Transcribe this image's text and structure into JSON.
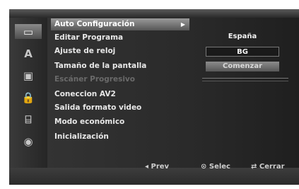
{
  "sidebar": {
    "icons": [
      {
        "name": "disc-settings-icon",
        "glyph": "▭"
      },
      {
        "name": "language-icon",
        "glyph": "A"
      },
      {
        "name": "audio-icon",
        "glyph": "▣"
      },
      {
        "name": "lock-icon",
        "glyph": "🔒"
      },
      {
        "name": "recording-icon",
        "glyph": "⌸"
      },
      {
        "name": "disc-icon",
        "glyph": "◉"
      }
    ],
    "active_index": 0
  },
  "menu": {
    "items": [
      {
        "label": "Auto Configuración",
        "state": "selected",
        "has_submenu": true
      },
      {
        "label": "Editar Programa",
        "state": "normal"
      },
      {
        "label": "Ajuste de reloj",
        "state": "normal"
      },
      {
        "label": "Tamaño de la pantalla",
        "state": "normal"
      },
      {
        "label": "Escáner Progresivo",
        "state": "disabled"
      },
      {
        "label": "Coneccion AV2",
        "state": "normal"
      },
      {
        "label": "Salida formato video",
        "state": "normal"
      },
      {
        "label": "Modo económico",
        "state": "normal"
      },
      {
        "label": "Inicialización",
        "state": "normal"
      }
    ],
    "submenu_arrow": "▶"
  },
  "options": {
    "country": "España",
    "system": "BG",
    "start_button": "Comenzar"
  },
  "footer": {
    "prev": "◂ Prev",
    "select": "⊙ Selec",
    "close": "⇄ Cerrar"
  },
  "colors": {
    "background": "#0d0d0d",
    "highlight": "#8a8a8a",
    "text": "#e8e8e8",
    "disabled_text": "#6a6a6a"
  }
}
